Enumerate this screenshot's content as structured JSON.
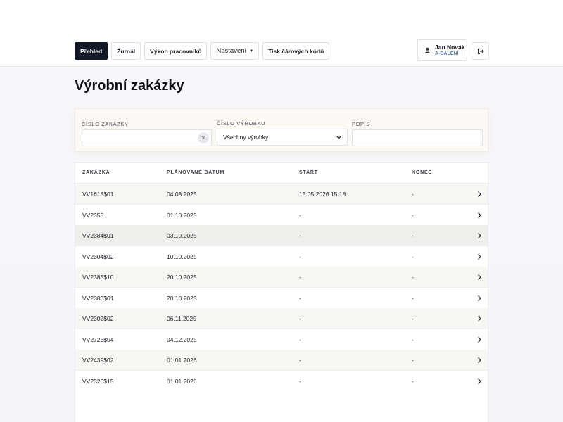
{
  "nav": {
    "items": [
      {
        "label": "Přehled",
        "name": "nav-prehled",
        "active": true
      },
      {
        "label": "Žurnál",
        "name": "nav-zurnal"
      },
      {
        "label": "Výkon pracovníků",
        "name": "nav-vykon-pracovniku"
      },
      {
        "label": "Nastavení",
        "name": "nav-nastaveni",
        "dropdown": true
      },
      {
        "label": "Tisk čárových kódů",
        "name": "nav-tisk-carovych-kodu"
      }
    ]
  },
  "user": {
    "name": "Jan Novák",
    "role": "A-BALENÍ",
    "icon": "user-icon"
  },
  "logout": {
    "icon": "logout-icon"
  },
  "page": {
    "title": "Výrobní zakázky"
  },
  "filters": {
    "order_number": {
      "label": "Číslo zakázky",
      "value": ""
    },
    "product_number": {
      "label": "Číslo výrobku",
      "selected": "Všechny výrobky"
    },
    "description": {
      "label": "Popis",
      "value": ""
    }
  },
  "table": {
    "headers": [
      "Zakázka",
      "Plánované datum",
      "Start",
      "Konec"
    ],
    "rows": [
      {
        "order": "VV1618$01",
        "planned": "04.08.2025",
        "start": "15.05.2026 15:18",
        "end": "-"
      },
      {
        "order": "VV2355",
        "planned": "01.10.2025",
        "start": "-",
        "end": "-"
      },
      {
        "order": "VV2384$01",
        "planned": "03.10.2025",
        "start": "-",
        "end": "-"
      },
      {
        "order": "VV2304$02",
        "planned": "10.10.2025",
        "start": "-",
        "end": "-"
      },
      {
        "order": "VV2385$10",
        "planned": "20.10.2025",
        "start": "-",
        "end": "-"
      },
      {
        "order": "VV2386$01",
        "planned": "20.10.2025",
        "start": "-",
        "end": "-"
      },
      {
        "order": "VV2302$02",
        "planned": "06.11.2025",
        "start": "-",
        "end": "-"
      },
      {
        "order": "VV2723$04",
        "planned": "04.12.2025",
        "start": "-",
        "end": "-"
      },
      {
        "order": "VV2439$02",
        "planned": "01.01.2026",
        "start": "-",
        "end": "-"
      },
      {
        "order": "VV2326$15",
        "planned": "01.01.2026",
        "start": "-",
        "end": "-"
      }
    ]
  }
}
